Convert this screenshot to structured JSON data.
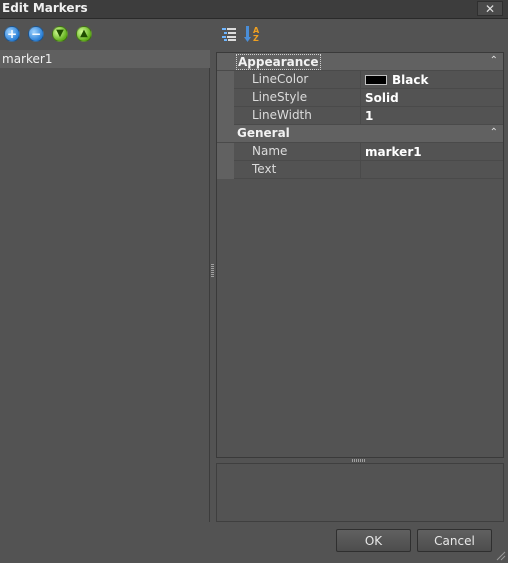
{
  "window": {
    "title": "Edit Markers",
    "close_label": "✕"
  },
  "toolbar": {
    "add_icon": "add-circle-icon",
    "remove_icon": "remove-circle-icon",
    "move_down_icon": "move-down-icon",
    "move_up_icon": "move-up-icon",
    "categorized_icon": "categorized-view-icon",
    "alphabetical_icon": "alphabetical-sort-icon"
  },
  "markers": {
    "items": [
      {
        "label": "marker1"
      }
    ]
  },
  "property_grid": {
    "categories": [
      {
        "label": "Appearance",
        "properties": [
          {
            "name": "LineColor",
            "value": "Black",
            "swatch_color": "#000000"
          },
          {
            "name": "LineStyle",
            "value": "Solid"
          },
          {
            "name": "LineWidth",
            "value": "1"
          }
        ]
      },
      {
        "label": "General",
        "properties": [
          {
            "name": "Name",
            "value": "marker1"
          },
          {
            "name": "Text",
            "value": ""
          }
        ]
      }
    ]
  },
  "buttons": {
    "ok": "OK",
    "cancel": "Cancel"
  }
}
